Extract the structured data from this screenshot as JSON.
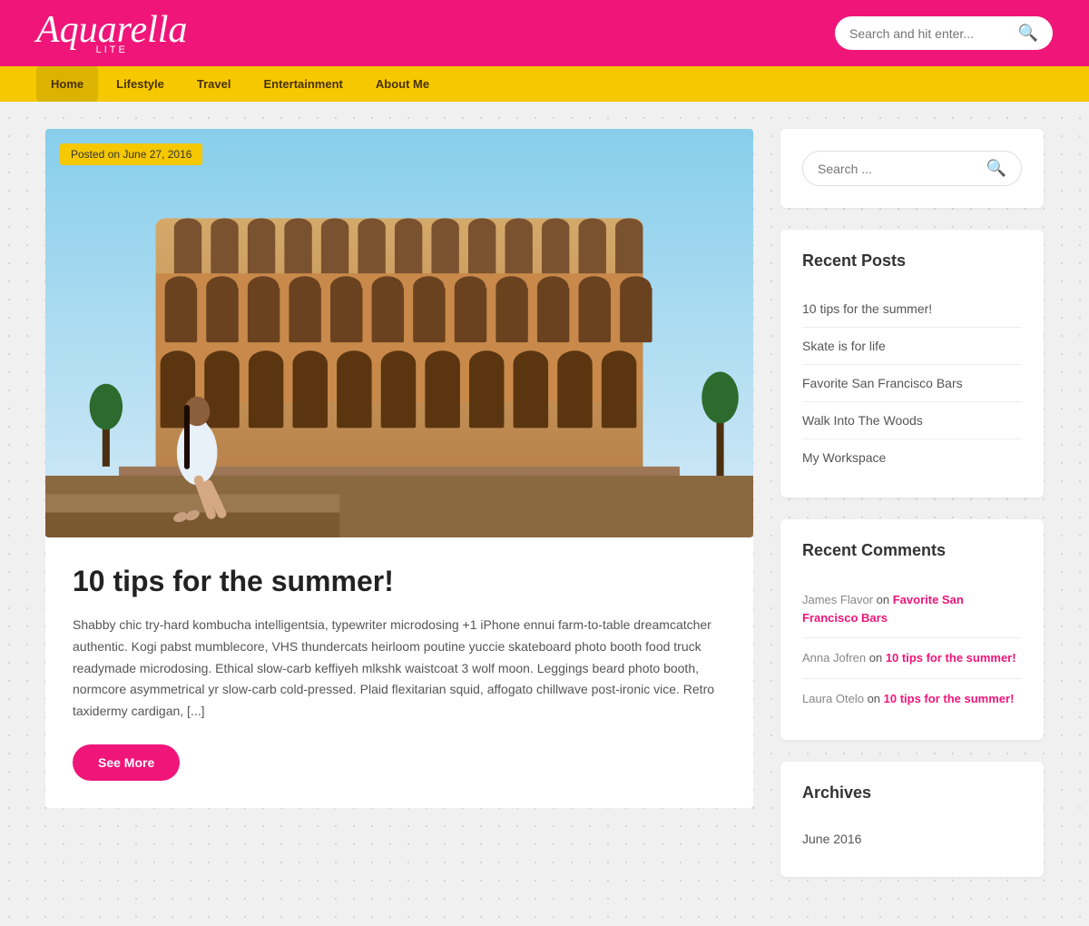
{
  "site": {
    "name": "Aquarella",
    "tagline": "LITE",
    "accent_pink": "#f01579",
    "accent_yellow": "#f5c800"
  },
  "header": {
    "search_placeholder": "Search and hit enter..."
  },
  "nav": {
    "items": [
      {
        "label": "Home",
        "active": true
      },
      {
        "label": "Lifestyle",
        "active": false
      },
      {
        "label": "Travel",
        "active": false
      },
      {
        "label": "Entertainment",
        "active": false
      },
      {
        "label": "About Me",
        "active": false
      }
    ]
  },
  "post": {
    "date_badge": "Posted on June 27, 2016",
    "title": "10 tips for the summer!",
    "excerpt": "Shabby chic try-hard kombucha intelligentsia, typewriter microdosing +1 iPhone ennui farm-to-table dreamcatcher authentic. Kogi pabst mumblecore, VHS thundercats heirloom poutine yuccie skateboard photo booth food truck readymade microdosing. Ethical slow-carb keffiyeh mlkshk waistcoat 3 wolf moon. Leggings beard photo booth, normcore asymmetrical yr slow-carb cold-pressed. Plaid flexitarian squid, affogato chillwave post-ironic vice. Retro taxidermy cardigan, [...]",
    "see_more_label": "See More"
  },
  "sidebar": {
    "search": {
      "placeholder": "Search ..."
    },
    "recent_posts": {
      "title": "Recent Posts",
      "items": [
        {
          "label": "10 tips for the summer!"
        },
        {
          "label": "Skate is for life"
        },
        {
          "label": "Favorite San Francisco Bars"
        },
        {
          "label": "Walk Into The Woods"
        },
        {
          "label": "My Workspace"
        }
      ]
    },
    "recent_comments": {
      "title": "Recent Comments",
      "items": [
        {
          "author": "James Flavor",
          "on": "on",
          "post": "Favorite San Francisco Bars"
        },
        {
          "author": "Anna Jofren",
          "on": "on",
          "post": "10 tips for the summer!"
        },
        {
          "author": "Laura Otelo",
          "on": "on",
          "post": "10 tips for the summer!"
        }
      ]
    },
    "archives": {
      "title": "Archives",
      "items": [
        {
          "label": "June 2016"
        }
      ]
    }
  }
}
